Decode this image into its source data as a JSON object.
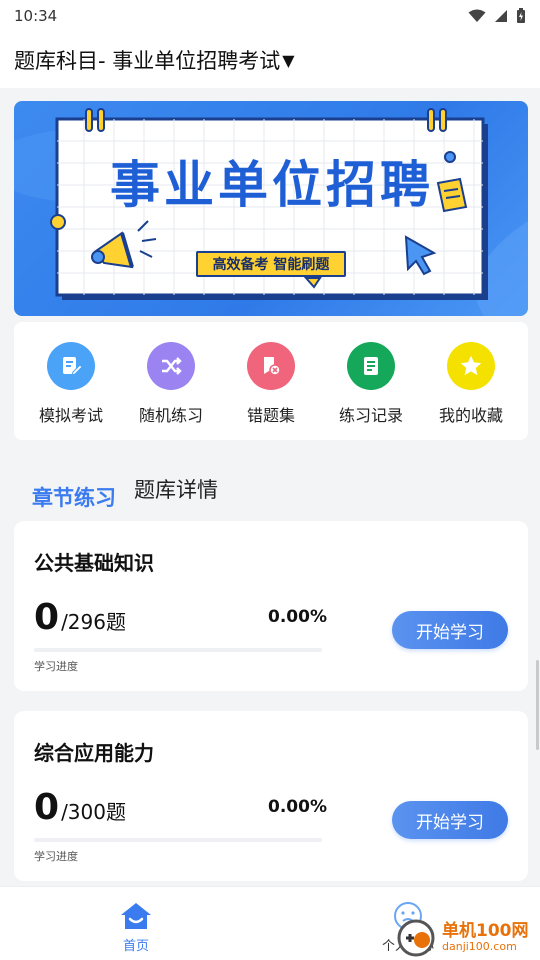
{
  "status": {
    "time": "10:34"
  },
  "header": {
    "title": "题库科目- 事业单位招聘考试",
    "caret": "▼"
  },
  "banner": {
    "title": "事业单位招聘",
    "subtitle": "高效备考 智能刷题"
  },
  "quick_actions": [
    {
      "label": "模拟考试",
      "icon": "edit-doc-icon",
      "color": "#4aa3f7"
    },
    {
      "label": "随机练习",
      "icon": "shuffle-icon",
      "color": "#9b84f2"
    },
    {
      "label": "错题集",
      "icon": "wrong-book-icon",
      "color": "#f0647c"
    },
    {
      "label": "练习记录",
      "icon": "record-icon",
      "color": "#16a85a"
    },
    {
      "label": "我的收藏",
      "icon": "star-icon",
      "color": "#f5e100"
    }
  ],
  "tabs": {
    "active": "章节练习",
    "other": "题库详情"
  },
  "cards": [
    {
      "title": "公共基础知识",
      "done": "0",
      "total": "/296题",
      "percent": "0.00%",
      "progress": 0,
      "progress_label": "学习进度",
      "button": "开始学习"
    },
    {
      "title": "综合应用能力",
      "done": "0",
      "total": "/300题",
      "percent": "0.00%",
      "progress": 0,
      "progress_label": "学习进度",
      "button": "开始学习"
    }
  ],
  "tabbar": {
    "home": "首页",
    "me": "个人中心"
  },
  "watermark": {
    "main": "单机100网",
    "sub": "danji100.com"
  }
}
